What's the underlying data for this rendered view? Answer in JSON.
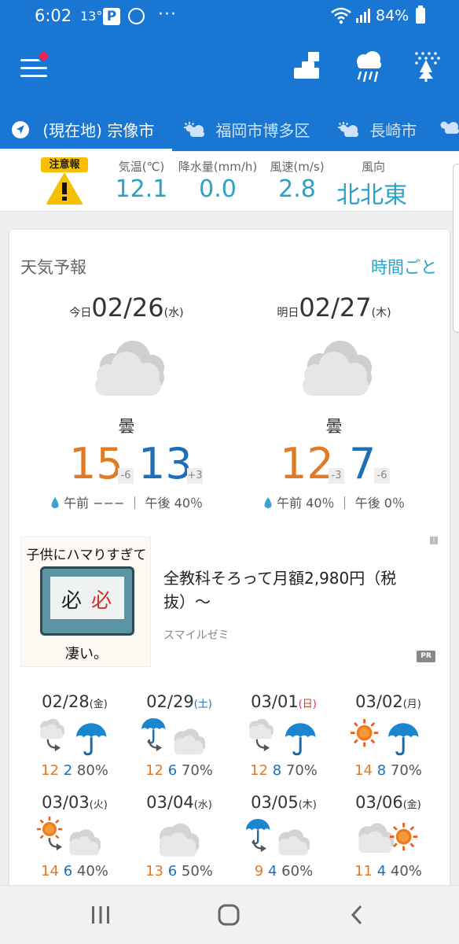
{
  "status_bar": {
    "time": "6:02",
    "temperature": "13°",
    "p_icon_label": "P",
    "more": "···",
    "battery": "84%"
  },
  "app_bar": {
    "icons": [
      "menu-icon",
      "ranking-icon",
      "rain-radar-icon",
      "snow-forest-icon"
    ]
  },
  "tabs": [
    {
      "label": "(現在地) 宗像市",
      "icon": "location-arrow-icon",
      "active": true
    },
    {
      "label": "福岡市博多区",
      "icon": "partly-cloudy-icon",
      "active": false
    },
    {
      "label": "長崎市",
      "icon": "partly-cloudy-icon",
      "active": false
    }
  ],
  "current": {
    "warning_label": "注意報",
    "labels": {
      "temp": "気温(℃)",
      "precip": "降水量(mm/h)",
      "wind_speed": "風速(m/s)",
      "wind_dir": "風向"
    },
    "values": {
      "temp": "12.1",
      "precip": "0.0",
      "wind_speed": "2.8",
      "wind_dir": "北北東"
    }
  },
  "forecast": {
    "title": "天気予報",
    "hourly_link": "時間ごと",
    "days": [
      {
        "prefix": "今日",
        "date": "02/26",
        "dow": "(水)",
        "condition": "曇",
        "high": "15",
        "high_diff": "-6",
        "low": "13",
        "low_diff": "+3",
        "precip": "午前 −−− ｜ 午後 40％"
      },
      {
        "prefix": "明日",
        "date": "02/27",
        "dow": "(木)",
        "condition": "曇",
        "high": "12",
        "high_diff": "-3",
        "low": "7",
        "low_diff": "-6",
        "precip": "午前 40％ ｜ 午後 0％"
      }
    ]
  },
  "ad": {
    "image_top_text": "子供にハマりすぎて",
    "image_bottom_text": "凄い。",
    "image_kanji_1": "必",
    "image_kanji_2": "必",
    "headline": "全教科そろって月額2,980円（税抜）〜",
    "sponsor": "スマイルゼミ",
    "pr_badge": "PR",
    "info_badge": "i"
  },
  "weekly": [
    {
      "date": "02/28",
      "dow": "(金)",
      "dow_color": "normal",
      "icon": "cloud-to-rain-icon",
      "high": "12",
      "low": "2",
      "pop": "80%"
    },
    {
      "date": "02/29",
      "dow": "(土)",
      "dow_color": "sat",
      "icon": "rain-to-cloud-icon",
      "high": "12",
      "low": "6",
      "pop": "70%"
    },
    {
      "date": "03/01",
      "dow": "(日)",
      "dow_color": "sun",
      "icon": "cloud-to-rain-icon",
      "high": "12",
      "low": "8",
      "pop": "70%"
    },
    {
      "date": "03/02",
      "dow": "(月)",
      "dow_color": "normal",
      "icon": "sun-and-rain-icon",
      "high": "14",
      "low": "8",
      "pop": "70%"
    },
    {
      "date": "03/03",
      "dow": "(火)",
      "dow_color": "normal",
      "icon": "sun-to-cloud-icon",
      "high": "14",
      "low": "6",
      "pop": "40%"
    },
    {
      "date": "03/04",
      "dow": "(水)",
      "dow_color": "normal",
      "icon": "cloud-icon",
      "high": "13",
      "low": "6",
      "pop": "50%"
    },
    {
      "date": "03/05",
      "dow": "(木)",
      "dow_color": "normal",
      "icon": "rain-to-cloud-icon",
      "high": "9",
      "low": "4",
      "pop": "60%"
    },
    {
      "date": "03/06",
      "dow": "(金)",
      "dow_color": "normal",
      "icon": "cloud-and-sun-icon",
      "high": "11",
      "low": "4",
      "pop": "40%"
    }
  ],
  "colors": {
    "app_blue": "#1976d2",
    "high_temp": "#e07b25",
    "low_temp": "#1f6fb5",
    "value_cyan": "#2aa3c8",
    "warning_yellow": "#f6c000"
  },
  "nav_bar": {
    "icons": [
      "recent-apps-icon",
      "home-icon",
      "back-icon"
    ]
  }
}
